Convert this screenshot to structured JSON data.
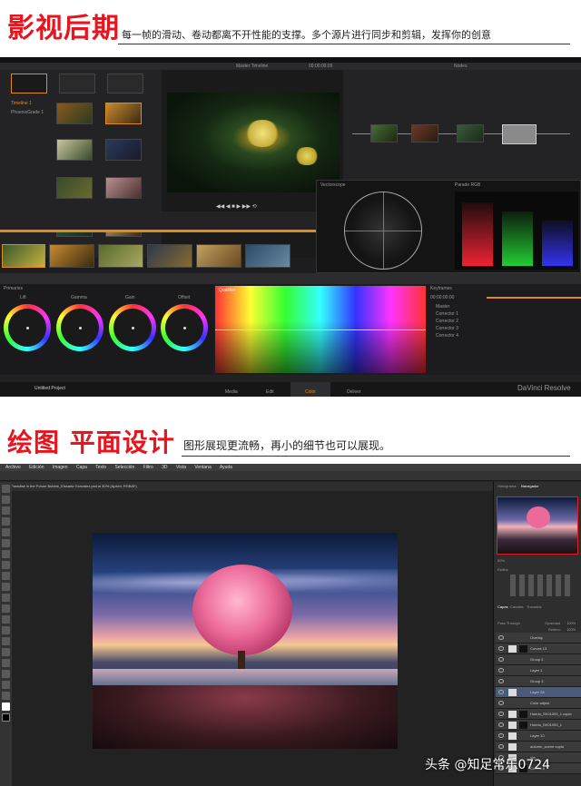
{
  "section1": {
    "title": "影视后期",
    "subtitle": "每一帧的滑动、卷动都离不开性能的支撑。多个源片进行同步和剪辑，发挥你的创意"
  },
  "section2": {
    "title": "绘图 平面设计",
    "subtitle": "图形展现更流畅，再小的细节也可以展现。"
  },
  "resolve": {
    "app_name": "DaVinci Resolve",
    "project_name": "Untitled Project",
    "timeline_name": "Master Timeline",
    "timecode": "00:00:00:00",
    "media_label": "Timeline 1",
    "clip_name": "PhoenixGrade 1",
    "wheels": [
      "Lift",
      "Gamma",
      "Gain",
      "Offset"
    ],
    "primaries_label": "Primaries",
    "qualifier_label": "Qualifier",
    "keyframes_label": "Keyframes",
    "nodes_label": "Nodes",
    "scopes_labels": [
      "Vectorscope",
      "Parade RGB"
    ],
    "bottom_tabs": [
      "Media",
      "Edit",
      "Color",
      "Deliver"
    ],
    "active_tab": "Color",
    "track_labels": [
      "V1",
      "V1",
      "V1",
      "V1",
      "V1",
      "V1"
    ],
    "clip_numbers": [
      "1.1.1",
      "1.1.2",
      "1.1.3",
      "1.1.4",
      "1.1.5",
      "1.1.6"
    ],
    "keyframe_tracks": [
      "Master",
      "Corrector 1",
      "Corrector 2",
      "Corrector 3",
      "Corrector 4"
    ],
    "footer_values": [
      "1.000",
      "0.500",
      "50.000",
      "50.000",
      "256.00",
      "1.00"
    ]
  },
  "photoshop": {
    "menu": [
      "Archivo",
      "Edición",
      "Imagen",
      "Capa",
      "Texto",
      "Selección",
      "Filtro",
      "3D",
      "Vista",
      "Ventana",
      "Ayuda"
    ],
    "doc_tab": "Paradise in the Future Bubble_Elssana Gonzalez.psd al 50% (Apichi, RGB/8*)",
    "panel_tabs": [
      "Histograma",
      "Navegador"
    ],
    "zoom": "50%",
    "styles_label": "Estilos",
    "layers_tabs": [
      "Capas",
      "Canales",
      "Trazados"
    ],
    "blend_mode": "Pass Through",
    "opacity_label": "Opacidad",
    "opacity": "100%",
    "fill_label": "Relleno",
    "fill": "100%",
    "layers": [
      "Overlay",
      "Curves 13",
      "Group 2",
      "Layer 1",
      "Group 3",
      "Layer 28",
      "Color adjust",
      "Hoedo_SK01093_1 copia",
      "Hoedo_SK01093_1",
      "Layer 10",
      "autumn_scene copia",
      "sky",
      "Curves 8"
    ]
  },
  "watermark": "头条 @知足常乐0724",
  "colors": {
    "brand_red": "#e8141e",
    "resolve_bg": "#1d1d1f",
    "ps_bg": "#262626",
    "accent_orange": "#e28a1e"
  }
}
